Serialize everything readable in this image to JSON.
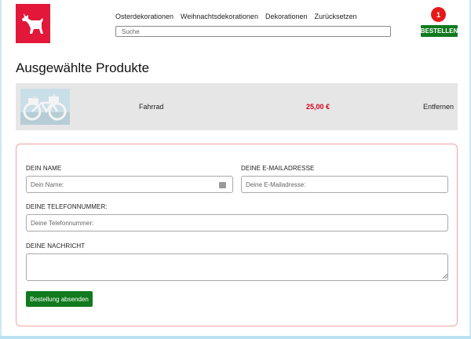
{
  "header": {
    "logo_icon": "dog-logo-icon",
    "brand_color": "#e2173a",
    "nav": [
      {
        "label": "Osterdekorationen"
      },
      {
        "label": "Weihnachtsdekorationen"
      },
      {
        "label": "Dekorationen"
      },
      {
        "label": "Zurücksetzen"
      }
    ],
    "search_placeholder": "Suche",
    "cart_count": "1",
    "order_label": "BESTELLEN",
    "accent_color": "#117a1e"
  },
  "page_title": "Ausgewählte Produkte",
  "products": [
    {
      "name": "Fahrrad",
      "price": "25,00 €",
      "remove_label": "Entfernen",
      "image_icon": "bicycle-decoration-image"
    }
  ],
  "form": {
    "name_label": "DEIN NAME",
    "name_placeholder": "Dein Name:",
    "email_label": "DEINE E-MAILADRESSE",
    "email_placeholder": "Deine E-Mailadresse:",
    "phone_label": "DEINE TELEFONNUMMER:",
    "phone_placeholder": "Deine Telefonnummer:",
    "message_label": "DEINE NACHRICHT",
    "submit_label": "Bestellung absenden"
  }
}
